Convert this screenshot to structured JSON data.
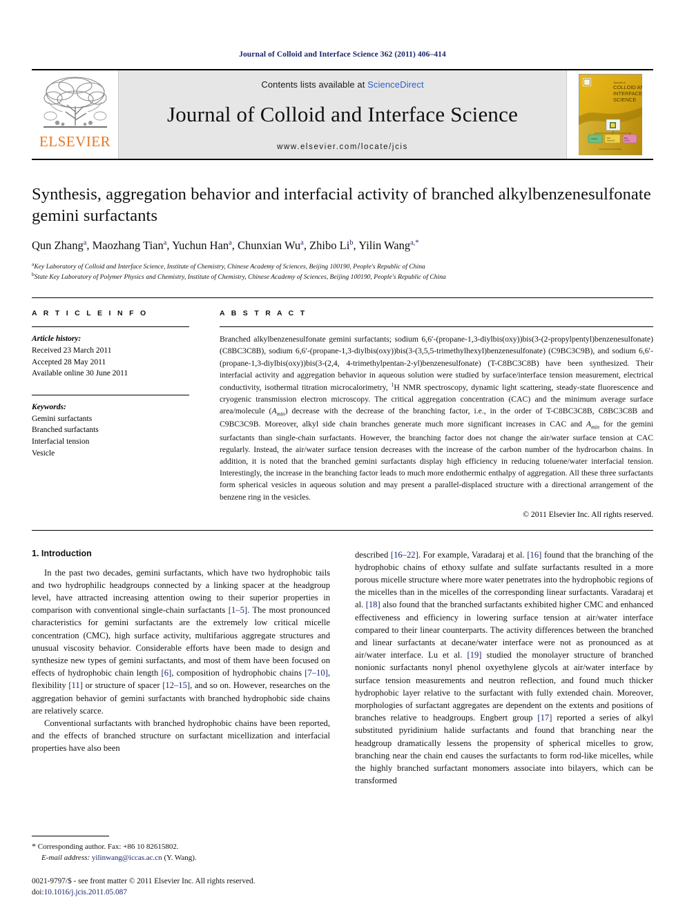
{
  "running_head": "Journal of Colloid and Interface Science 362 (2011) 406–414",
  "masthead": {
    "contents_prefix": "Contents lists available at ",
    "sciencedirect": "ScienceDirect",
    "journal_title": "Journal of Colloid and Interface Science",
    "journal_url": "www.elsevier.com/locate/jcis",
    "publisher_logo_text": "ELSEVIER",
    "cover_title_line1": "Journal of",
    "cover_title_line2": "COLLOID AND",
    "cover_title_line3": "INTERFACE",
    "cover_title_line4": "SCIENCE",
    "accent_color": "#2b5fc9",
    "elsevier_orange": "#e87722"
  },
  "article": {
    "title": "Synthesis, aggregation behavior and interfacial activity of branched alkylbenzenesulfonate gemini surfactants",
    "authors": [
      {
        "name": "Qun Zhang",
        "sup": "a"
      },
      {
        "name": "Maozhang Tian",
        "sup": "a"
      },
      {
        "name": "Yuchun Han",
        "sup": "a"
      },
      {
        "name": "Chunxian Wu",
        "sup": "a"
      },
      {
        "name": "Zhibo Li",
        "sup": "b"
      },
      {
        "name": "Yilin Wang",
        "sup": "a,*"
      }
    ],
    "affiliations": [
      {
        "marker": "a",
        "text": "Key Laboratory of Colloid and Interface Science, Institute of Chemistry, Chinese Academy of Sciences, Beijing 100190, People's Republic of China"
      },
      {
        "marker": "b",
        "text": "State Key Laboratory of Polymer Physics and Chemistry, Institute of Chemistry, Chinese Academy of Sciences, Beijing 100190, People's Republic of China"
      }
    ]
  },
  "article_info": {
    "heading": "A R T I C L E   I N F O",
    "history_label": "Article history:",
    "history": [
      "Received 23 March 2011",
      "Accepted 28 May 2011",
      "Available online 30 June 2011"
    ],
    "keywords_label": "Keywords:",
    "keywords": [
      "Gemini surfactants",
      "Branched surfactants",
      "Interfacial tension",
      "Vesicle"
    ]
  },
  "abstract": {
    "heading": "A B S T R A C T",
    "paragraph_1": "Branched alkylbenzenesulfonate gemini surfactants; sodium 6,6′-(propane-1,3-diylbis(oxy))bis(3-(2-propylpentyl)benzenesulfonate) (C8BC3C8B), sodium 6,6′-(propane-1,3-diylbis(oxy))bis(3-(3,5,5-trimethylhexyl)benzenesulfonate) (C9BC3C9B), and sodium 6,6′-(propane-1,3-diylbis(oxy))bis(3-(2,4, 4-trimethylpentan-2-yl)benzenesulfonate) (T-C8BC3C8B) have been synthesized. Their interfacial activity and aggregation behavior in aqueous solution were studied by surface/interface tension measurement, electrical conductivity, isothermal titration microcalorimetry, ",
    "nmr_sup": "1",
    "paragraph_2": "H NMR spectroscopy, dynamic light scattering, steady-state fluorescence and cryogenic transmission electron microscopy. The critical aggregation concentration (CAC) and the minimum average surface area/molecule (",
    "amin_1_base": "A",
    "amin_1_sub": "min",
    "paragraph_3": ") decrease with the decrease of the branching factor, i.e., in the order of T-C8BC3C8B, C8BC3C8B and C9BC3C9B. Moreover, alkyl side chain branches generate much more significant increases in CAC and ",
    "amin_2_base": "A",
    "amin_2_sub": "min",
    "paragraph_4": " for the gemini surfactants than single-chain surfactants. However, the branching factor does not change the air/water surface tension at CAC regularly. Instead, the air/water surface tension decreases with the increase of the carbon number of the hydrocarbon chains. In addition, it is noted that the branched gemini surfactants display high efficiency in reducing toluene/water interfacial tension. Interestingly, the increase in the branching factor leads to much more endothermic enthalpy of aggregation. All these three surfactants form spherical vesicles in aqueous solution and may present a parallel-displaced structure with a directional arrangement of the benzene ring in the vesicles.",
    "copyright": "© 2011 Elsevier Inc. All rights reserved."
  },
  "introduction": {
    "heading": "1. Introduction",
    "left_paragraphs": [
      {
        "indent": true,
        "runs": [
          {
            "t": "In the past two decades, gemini surfactants, which have two hydrophobic tails and two hydrophilic headgroups connected by a linking spacer at the headgroup level, have attracted increasing attention owing to their superior properties in comparison with conventional single-chain surfactants "
          },
          {
            "t": "[1–5]",
            "ref": true
          },
          {
            "t": ". The most pronounced characteristics for gemini surfactants are the extremely low critical micelle concentration (CMC), high surface activity, multifarious aggregate structures and unusual viscosity behavior. Considerable efforts have been made to design and synthesize new types of gemini surfactants, and most of them have been focused on effects of hydrophobic chain length "
          },
          {
            "t": "[6]",
            "ref": true
          },
          {
            "t": ", composition of hydrophobic chains "
          },
          {
            "t": "[7–10]",
            "ref": true
          },
          {
            "t": ", flexibility "
          },
          {
            "t": "[11]",
            "ref": true
          },
          {
            "t": " or structure of spacer "
          },
          {
            "t": "[12–15]",
            "ref": true
          },
          {
            "t": ", and so on. However, researches on the aggregation behavior of gemini surfactants with branched hydrophobic side chains are relatively scarce."
          }
        ]
      },
      {
        "indent": true,
        "runs": [
          {
            "t": "Conventional surfactants with branched hydrophobic chains have been reported, and the effects of branched structure on surfactant micellization and interfacial properties have also been"
          }
        ]
      }
    ],
    "right_paragraphs": [
      {
        "indent": false,
        "runs": [
          {
            "t": "described "
          },
          {
            "t": "[16–22]",
            "ref": true
          },
          {
            "t": ". For example, Varadaraj et al. "
          },
          {
            "t": "[16]",
            "ref": true
          },
          {
            "t": " found that the branching of the hydrophobic chains of ethoxy sulfate and sulfate surfactants resulted in a more porous micelle structure where more water penetrates into the hydrophobic regions of the micelles than in the micelles of the corresponding linear surfactants. Varadaraj et al. "
          },
          {
            "t": "[18]",
            "ref": true
          },
          {
            "t": " also found that the branched surfactants exhibited higher CMC and enhanced effectiveness and efficiency in lowering surface tension at air/water interface compared to their linear counterparts. The activity differences between the branched and linear surfactants at decane/water interface were not as pronounced as at air/water interface. Lu et al. "
          },
          {
            "t": "[19]",
            "ref": true
          },
          {
            "t": " studied the monolayer structure of branched nonionic surfactants nonyl phenol oxyethylene glycols at air/water interface by surface tension measurements and neutron reflection, and found much thicker hydrophobic layer relative to the surfactant with fully extended chain. Moreover, morphologies of surfactant aggregates are dependent on the extents and positions of branches relative to headgroups. Engbert group "
          },
          {
            "t": "[17]",
            "ref": true
          },
          {
            "t": " reported a series of alkyl substituted pyridinium halide surfactants and found that branching near the headgroup dramatically lessens the propensity of spherical micelles to grow, branching near the chain end causes the surfactants to form rod-like micelles, while the highly branched surfactant monomers associate into bilayers, which can be transformed"
          }
        ]
      }
    ]
  },
  "footer": {
    "corresponding_marker": "*",
    "corresponding_text": "Corresponding author. Fax: +86 10 82615802.",
    "email_label": "E-mail address:",
    "email": "yilinwang@iccas.ac.cn",
    "email_suffix": "(Y. Wang).",
    "imprint_line": "0021-9797/$ - see front matter © 2011 Elsevier Inc. All rights reserved.",
    "doi_label": "doi:",
    "doi_value": "10.1016/j.jcis.2011.05.087"
  }
}
